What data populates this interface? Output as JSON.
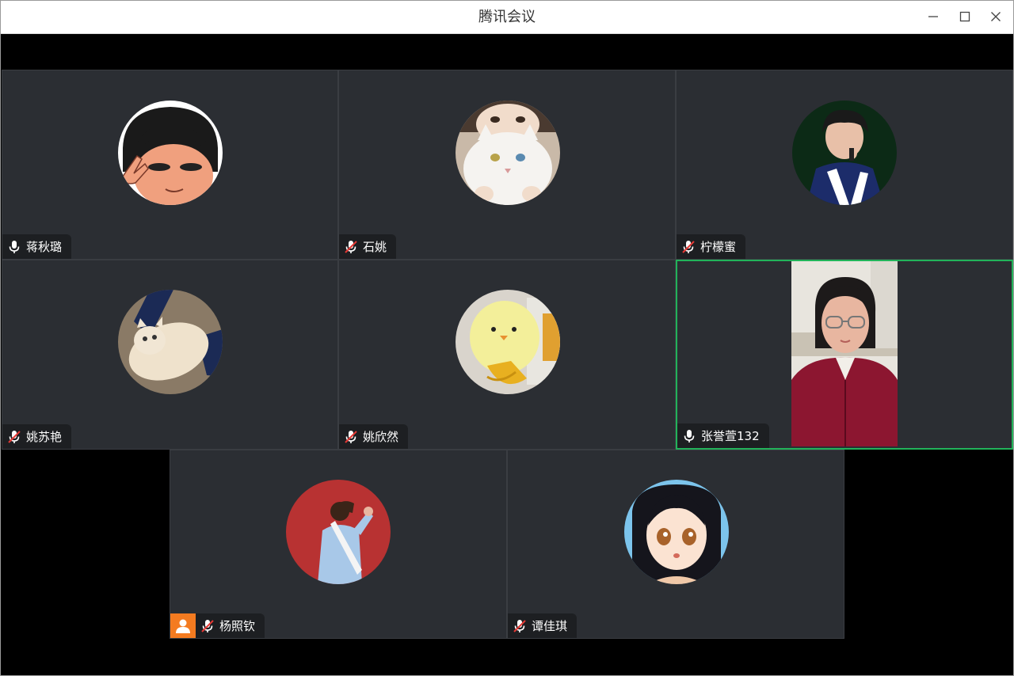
{
  "window": {
    "title": "腾讯会议"
  },
  "participants": [
    {
      "name": "蒋秋璐",
      "muted": false
    },
    {
      "name": "石姚",
      "muted": true
    },
    {
      "name": "柠檬蜜",
      "muted": true
    },
    {
      "name": "姚苏艳",
      "muted": true
    },
    {
      "name": "姚欣然",
      "muted": true
    },
    {
      "name": "张誉萱132",
      "muted": false,
      "video_on": true,
      "speaking": true
    },
    {
      "name": "杨照钦",
      "muted": true,
      "is_host": true
    },
    {
      "name": "谭佳琪",
      "muted": true
    }
  ],
  "icons": {
    "minimize": "minimize-icon",
    "maximize": "maximize-icon",
    "close": "close-icon",
    "mic_on": "microphone-icon",
    "mic_off": "microphone-muted-icon",
    "host": "host-user-icon"
  },
  "colors": {
    "tile_bg": "#2b2e33",
    "nametag_bg": "#1d1f22",
    "speaking_border": "#22b35a",
    "muted_red": "#e53935",
    "host_badge": "#f47b20"
  }
}
